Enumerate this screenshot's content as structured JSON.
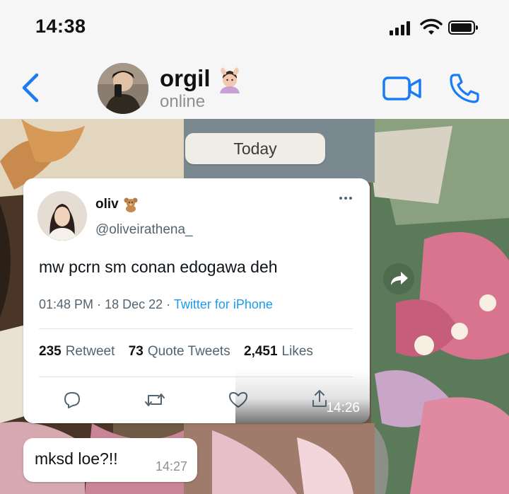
{
  "status_bar": {
    "time": "14:38"
  },
  "header": {
    "contact_name": "orgil",
    "presence": "online"
  },
  "chat": {
    "date_label": "Today",
    "messages": [
      {
        "type": "tweet",
        "tweet": {
          "name": "oliv",
          "handle": "@oliveirathena_",
          "text": "mw pcrn sm conan edogawa deh",
          "time": "01:48 PM",
          "sep1": "·",
          "date": "18 Dec 22",
          "sep2": "·",
          "source": "Twitter for iPhone",
          "retweets_count": "235",
          "retweets_label": "Retweet",
          "quotes_count": "73",
          "quotes_label": "Quote Tweets",
          "likes_count": "2,451",
          "likes_label": "Likes"
        },
        "timestamp": "14:26"
      },
      {
        "type": "text",
        "text": "mksd loe?!!",
        "timestamp": "14:27"
      }
    ]
  },
  "colors": {
    "accent": "#1a7cf5",
    "twitter_blue": "#1d9bf0"
  }
}
